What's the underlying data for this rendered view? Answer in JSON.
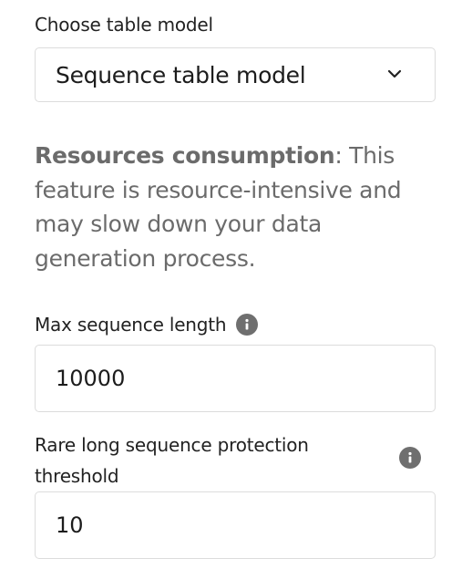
{
  "table_model": {
    "label": "Choose table model",
    "selected": "Sequence table model",
    "chevron_icon": "chevron-down-icon"
  },
  "warning": {
    "strong": "Resources consumption",
    "text": ": This feature is resource-intensive and may slow down your data generation process."
  },
  "max_sequence_length": {
    "label": "Max sequence length",
    "value": "10000",
    "info_icon": "info-icon"
  },
  "rare_long_sequence": {
    "label": "Rare long sequence protection threshold",
    "value": "10",
    "info_icon": "info-icon"
  },
  "colors": {
    "border": "#dcdcdc",
    "muted_text": "#6b6b6b",
    "icon_bg": "#6f6f6f"
  }
}
